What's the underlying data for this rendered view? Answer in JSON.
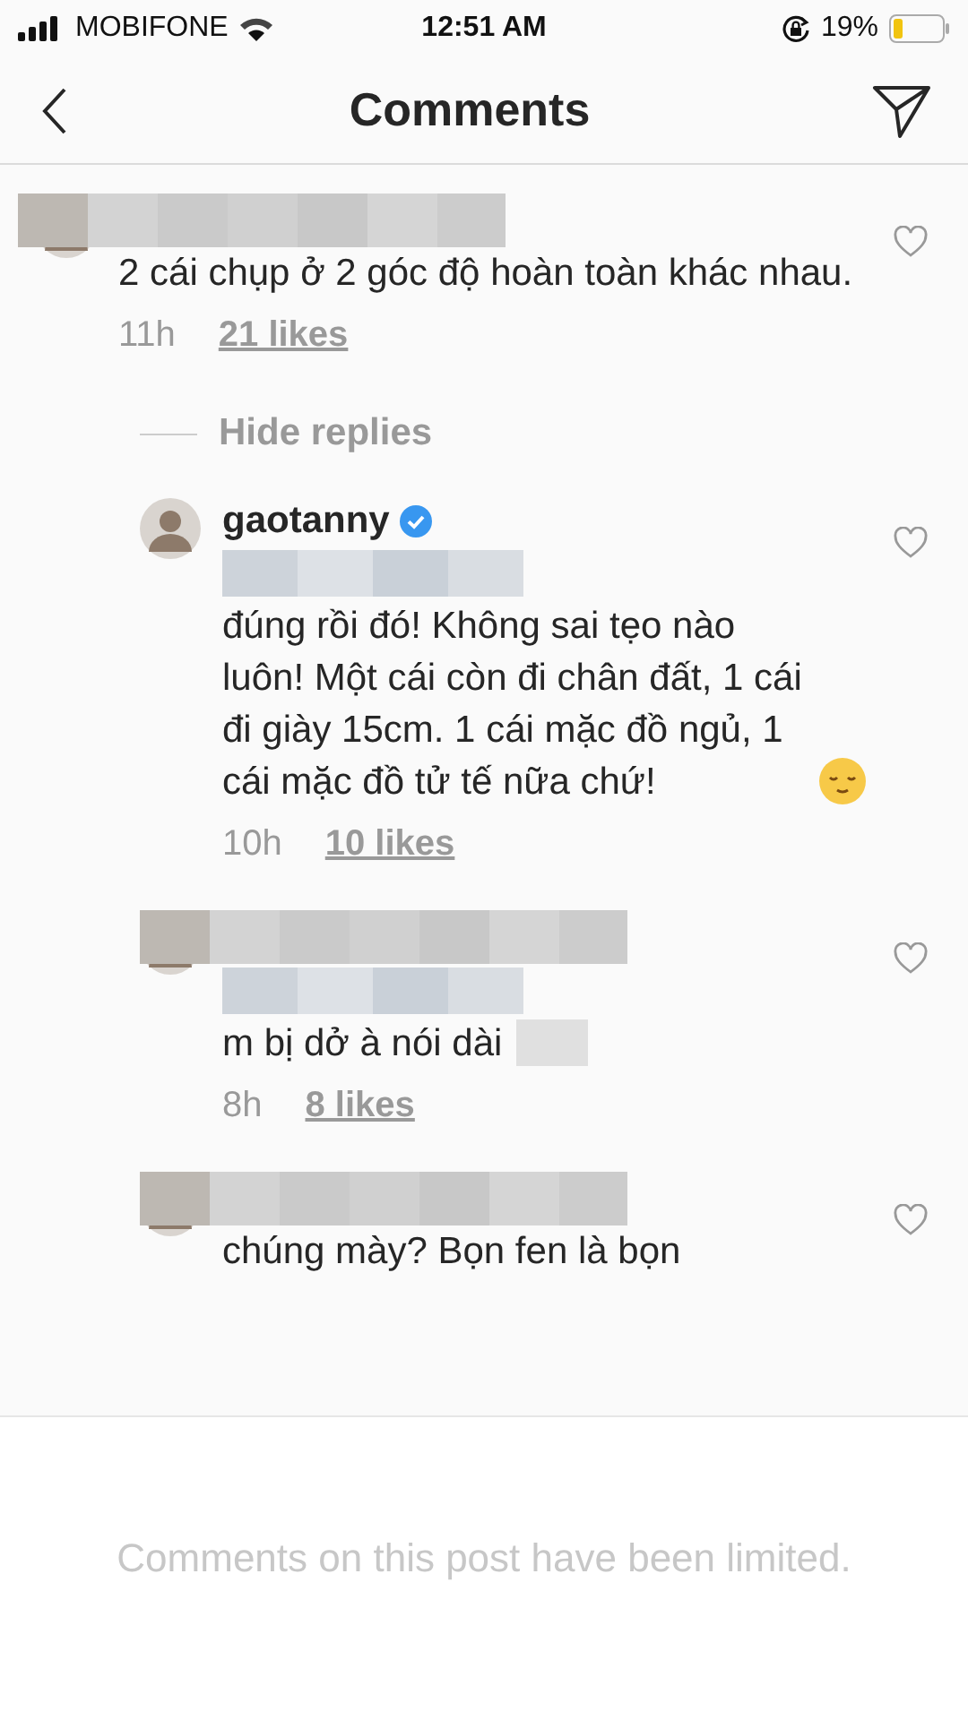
{
  "status_bar": {
    "carrier": "MOBIFONE",
    "time": "12:51 AM",
    "battery": "19%"
  },
  "nav": {
    "title": "Comments"
  },
  "comments": [
    {
      "kind": "comment",
      "username_hidden": true,
      "mention_hidden": false,
      "text": "2 cái chụp ở 2 góc độ hoàn toàn khác nhau.",
      "time": "11h",
      "likes": "21 likes",
      "liked": false
    },
    {
      "kind": "toggle",
      "label": "Hide replies"
    },
    {
      "kind": "reply",
      "username": "gaotanny",
      "verified": true,
      "username_hidden": false,
      "mention_hidden": true,
      "text": "đúng rồi đó! Không sai tẹo nào luôn! Một cái còn đi chân đất, 1 cái đi giày 15cm. 1 cái mặc đồ ngủ, 1 cái mặc đồ tử tế nữa chứ!",
      "emoji": true,
      "time": "10h",
      "likes": "10 likes",
      "liked": false
    },
    {
      "kind": "reply",
      "username_hidden": true,
      "mention_hidden": true,
      "text": "m bị dở à nói dài",
      "tail_hidden": true,
      "time": "8h",
      "likes": "8 likes",
      "liked": false
    },
    {
      "kind": "reply",
      "username_hidden": true,
      "mention_hidden": false,
      "text": "chúng mày? Bọn fen là bọn",
      "liked": false
    }
  ],
  "footer": {
    "notice": "Comments on this post have been limited."
  }
}
